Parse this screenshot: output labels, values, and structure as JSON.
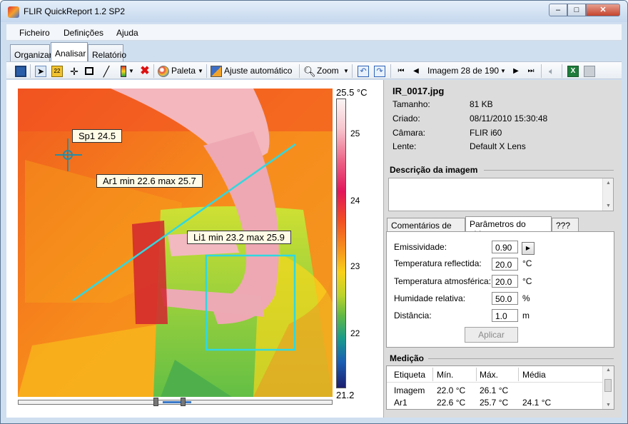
{
  "window": {
    "title": "FLIR QuickReport 1.2 SP2",
    "minimize": "–",
    "maximize": "□",
    "close": "✕"
  },
  "menu": [
    "Ficheiro",
    "Definições",
    "Ajuda"
  ],
  "tabs": [
    "Organizar",
    "Analisar",
    "Relatório"
  ],
  "toolbar": {
    "palette": "Paleta",
    "auto_adjust": "Ajuste automático",
    "zoom": "Zoom",
    "image_counter": "Imagem 28 de 190"
  },
  "ir": {
    "spot": "Sp1 24.5",
    "area": "Ar1 min 22.6 max 25.7",
    "line": "Li1 min 23.2 max 25.9",
    "scale_max": "25.5 °C",
    "scale_ticks": [
      "25",
      "24",
      "23",
      "22"
    ],
    "scale_min": "21.2"
  },
  "file": {
    "name": "IR_0017.jpg",
    "size_label": "Tamanho:",
    "size": "81 KB",
    "created_label": "Criado:",
    "created": "08/11/2010 15:30:48",
    "camera_label": "Câmara:",
    "camera": "FLIR i60",
    "lens_label": "Lente:",
    "lens": "Default X Lens"
  },
  "description_title": "Descrição da imagem",
  "ptabs": [
    "Comentários de texto",
    "Parâmetros do objecto",
    "???"
  ],
  "params": {
    "emissivity_label": "Emissividade:",
    "emissivity": "0.90",
    "refl_label": "Temperatura reflectida:",
    "refl": "20.0",
    "refl_unit": "°C",
    "atm_label": "Temperatura atmosférica:",
    "atm": "20.0",
    "atm_unit": "°C",
    "hum_label": "Humidade relativa:",
    "hum": "50.0",
    "hum_unit": "%",
    "dist_label": "Distância:",
    "dist": "1.0",
    "dist_unit": "m",
    "apply": "Aplicar"
  },
  "measurement": {
    "title": "Medição",
    "headers": [
      "Etiqueta",
      "Mín.",
      "Máx.",
      "Média"
    ],
    "rows": [
      [
        "Imagem",
        "22.0 °C",
        "26.1 °C",
        ""
      ],
      [
        "Ar1",
        "22.6 °C",
        "25.7 °C",
        "24.1 °C"
      ]
    ]
  }
}
